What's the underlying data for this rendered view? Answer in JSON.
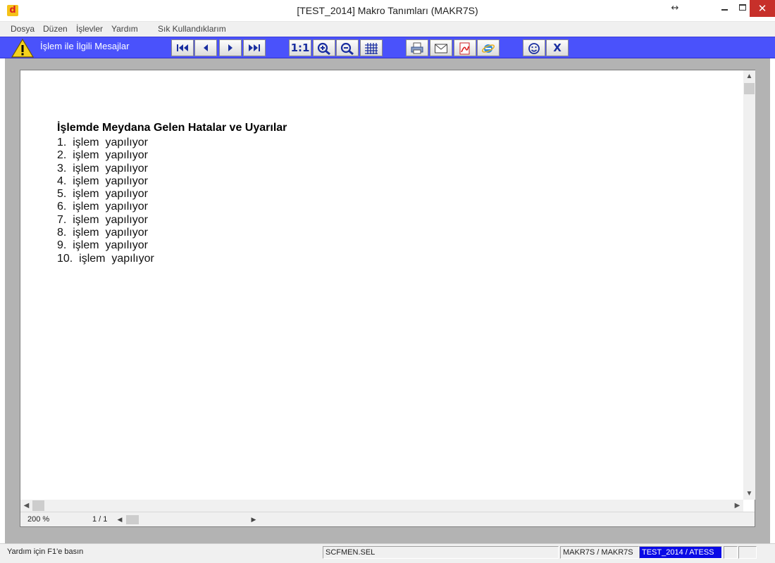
{
  "window": {
    "title": "[TEST_2014] Makro Tanımları (MAKR7S)",
    "app_icon_letter": "d",
    "resize_symbol": "↔",
    "close_symbol": "✕"
  },
  "menu": {
    "items": [
      "Dosya",
      "Düzen",
      "İşlevler",
      "Yardım",
      "Sık Kullandıklarım"
    ]
  },
  "toolbar": {
    "title": "İşlem ile İlgili Mesajlar",
    "buttons": [
      {
        "name": "first-page-button",
        "icon": "first-page-icon"
      },
      {
        "name": "previous-page-button",
        "icon": "previous-page-icon"
      },
      {
        "name": "next-page-button",
        "icon": "next-page-icon"
      },
      {
        "name": "last-page-button",
        "icon": "last-page-icon"
      },
      {
        "name": "actual-size-button",
        "label": "1:1"
      },
      {
        "name": "zoom-in-button",
        "icon": "zoom-in-icon"
      },
      {
        "name": "zoom-out-button",
        "icon": "zoom-out-icon"
      },
      {
        "name": "grid-button",
        "icon": "grid-icon"
      },
      {
        "name": "print-button",
        "icon": "printer-icon"
      },
      {
        "name": "email-button",
        "icon": "envelope-icon"
      },
      {
        "name": "pdf-button",
        "icon": "pdf-icon"
      },
      {
        "name": "browser-button",
        "icon": "internet-explorer-icon"
      },
      {
        "name": "smiley-button",
        "icon": "smiley-icon"
      },
      {
        "name": "close-report-button",
        "label": "X"
      }
    ],
    "accent_color": "#4a52fb"
  },
  "report": {
    "heading": "İşlemde Meydana Gelen Hatalar ve Uyarılar",
    "lines": [
      "1.  işlem  yapılıyor",
      "2.  işlem  yapılıyor",
      "3.  işlem  yapılıyor",
      "4.  işlem  yapılıyor",
      "5.  işlem  yapılıyor",
      "6.  işlem  yapılıyor",
      "7.  işlem  yapılıyor",
      "8.  işlem  yapılıyor",
      "9.  işlem  yapılıyor",
      "10.  işlem  yapılıyor"
    ]
  },
  "viewer_status": {
    "zoom": "200 %",
    "page": "1 / 1"
  },
  "statusbar": {
    "help": "Yardım için F1'e basın",
    "file": "SCFMEN.SEL",
    "macro": "MAKR7S / MAKR7S",
    "company": "TEST_2014 / ATESS",
    "company_bg_color": "#0a0ae6"
  }
}
